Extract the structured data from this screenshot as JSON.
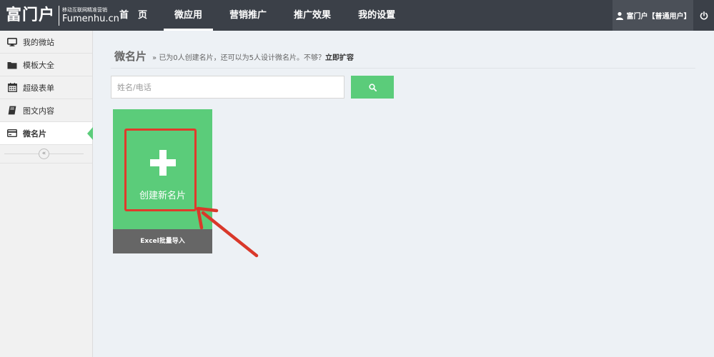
{
  "brand": {
    "name": "富门户",
    "tagline": "移动互联网精准营销",
    "domain": "Fumenhu.cn"
  },
  "nav": {
    "items": [
      {
        "label": "首　页"
      },
      {
        "label": "微应用"
      },
      {
        "label": "营销推广"
      },
      {
        "label": "推广效果"
      },
      {
        "label": "我的设置"
      }
    ],
    "active": "微应用"
  },
  "user": {
    "label": "富门户【普通用户】",
    "icon": "user-icon",
    "logout_icon": "power-icon"
  },
  "sidebar": {
    "items": [
      {
        "label": "我的微站",
        "icon": "monitor-icon"
      },
      {
        "label": "模板大全",
        "icon": "folder-icon"
      },
      {
        "label": "超级表单",
        "icon": "calendar-icon"
      },
      {
        "label": "图文内容",
        "icon": "book-icon"
      },
      {
        "label": "微名片",
        "icon": "card-icon"
      }
    ],
    "active": "微名片",
    "collapse_label": "«"
  },
  "page": {
    "title": "微名片",
    "info": "» 已为0人创建名片，还可以为5人设计微名片。不够？",
    "expand_link": "立即扩容"
  },
  "search": {
    "placeholder": "姓名/电话",
    "value": "",
    "button_icon": "search-icon"
  },
  "create_card": {
    "label": "创建新名片",
    "icon": "plus-icon",
    "import_label": "Excel批量导入"
  },
  "colors": {
    "topbar": "#3b4048",
    "accent_green": "#5bcc7a",
    "annotation_red": "#e03a2b"
  }
}
